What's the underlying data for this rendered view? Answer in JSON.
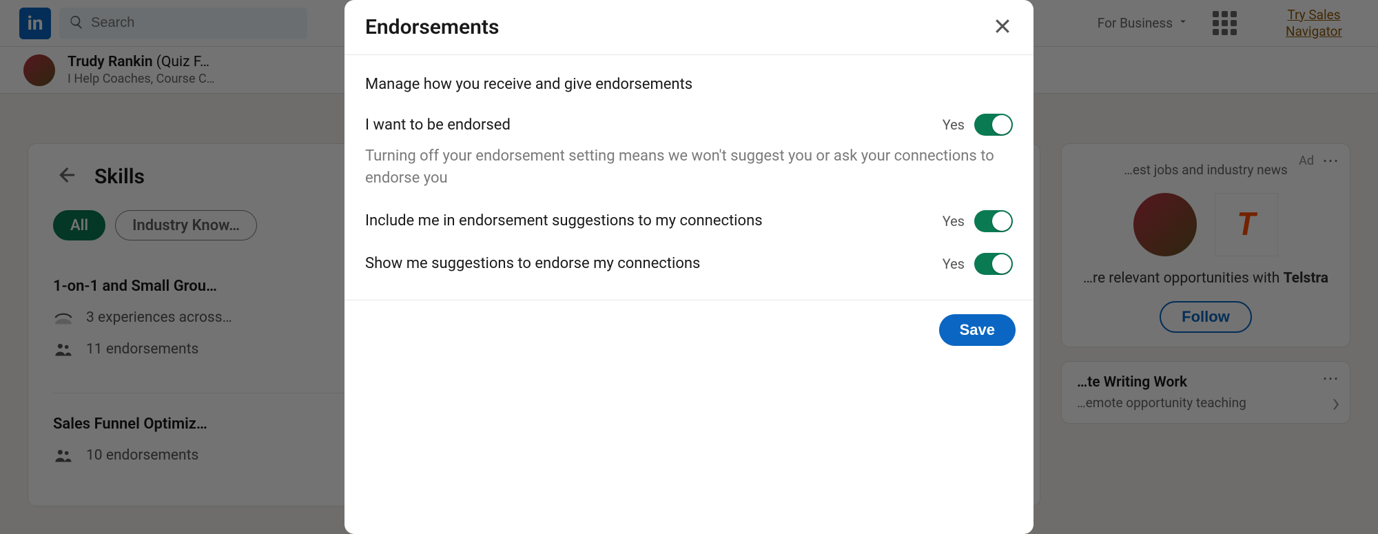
{
  "nav": {
    "search_placeholder": "Search",
    "business_label": "For Business",
    "try_link": "Try Sales Navigator"
  },
  "identity": {
    "name": "Trudy Rankin",
    "name_suffix": "(Quiz F…",
    "subtitle": "I Help Coaches, Course C…"
  },
  "skills": {
    "title": "Skills",
    "chips": [
      {
        "label": "All",
        "active": true
      },
      {
        "label": "Industry Know…",
        "active": false
      }
    ],
    "items": [
      {
        "name": "1-on-1 and Small Grou…",
        "experiences": "3 experiences across…",
        "endorsements": "11 endorsements"
      },
      {
        "name": "Sales Funnel Optimiz…",
        "endorsements": "10 endorsements"
      }
    ]
  },
  "ad": {
    "tag": "Ad",
    "subtitle": "…est jobs and industry news",
    "company_glyph": "T",
    "copy_prefix": "…re relevant opportunities with ",
    "company_name": "Telstra",
    "follow_label": "Follow"
  },
  "promo": {
    "title": "…te Writing Work",
    "subtitle": "…emote opportunity teaching"
  },
  "modal": {
    "title": "Endorsements",
    "lead": "Manage how you receive and give endorsements",
    "options": [
      {
        "label": "I want to be endorsed",
        "state": "Yes",
        "on": true,
        "desc": "Turning off your endorsement setting means we won't suggest you or ask your connections to endorse you"
      },
      {
        "label": "Include me in endorsement suggestions to my connections",
        "state": "Yes",
        "on": true
      },
      {
        "label": "Show me suggestions to endorse my connections",
        "state": "Yes",
        "on": true
      }
    ],
    "save_label": "Save"
  }
}
